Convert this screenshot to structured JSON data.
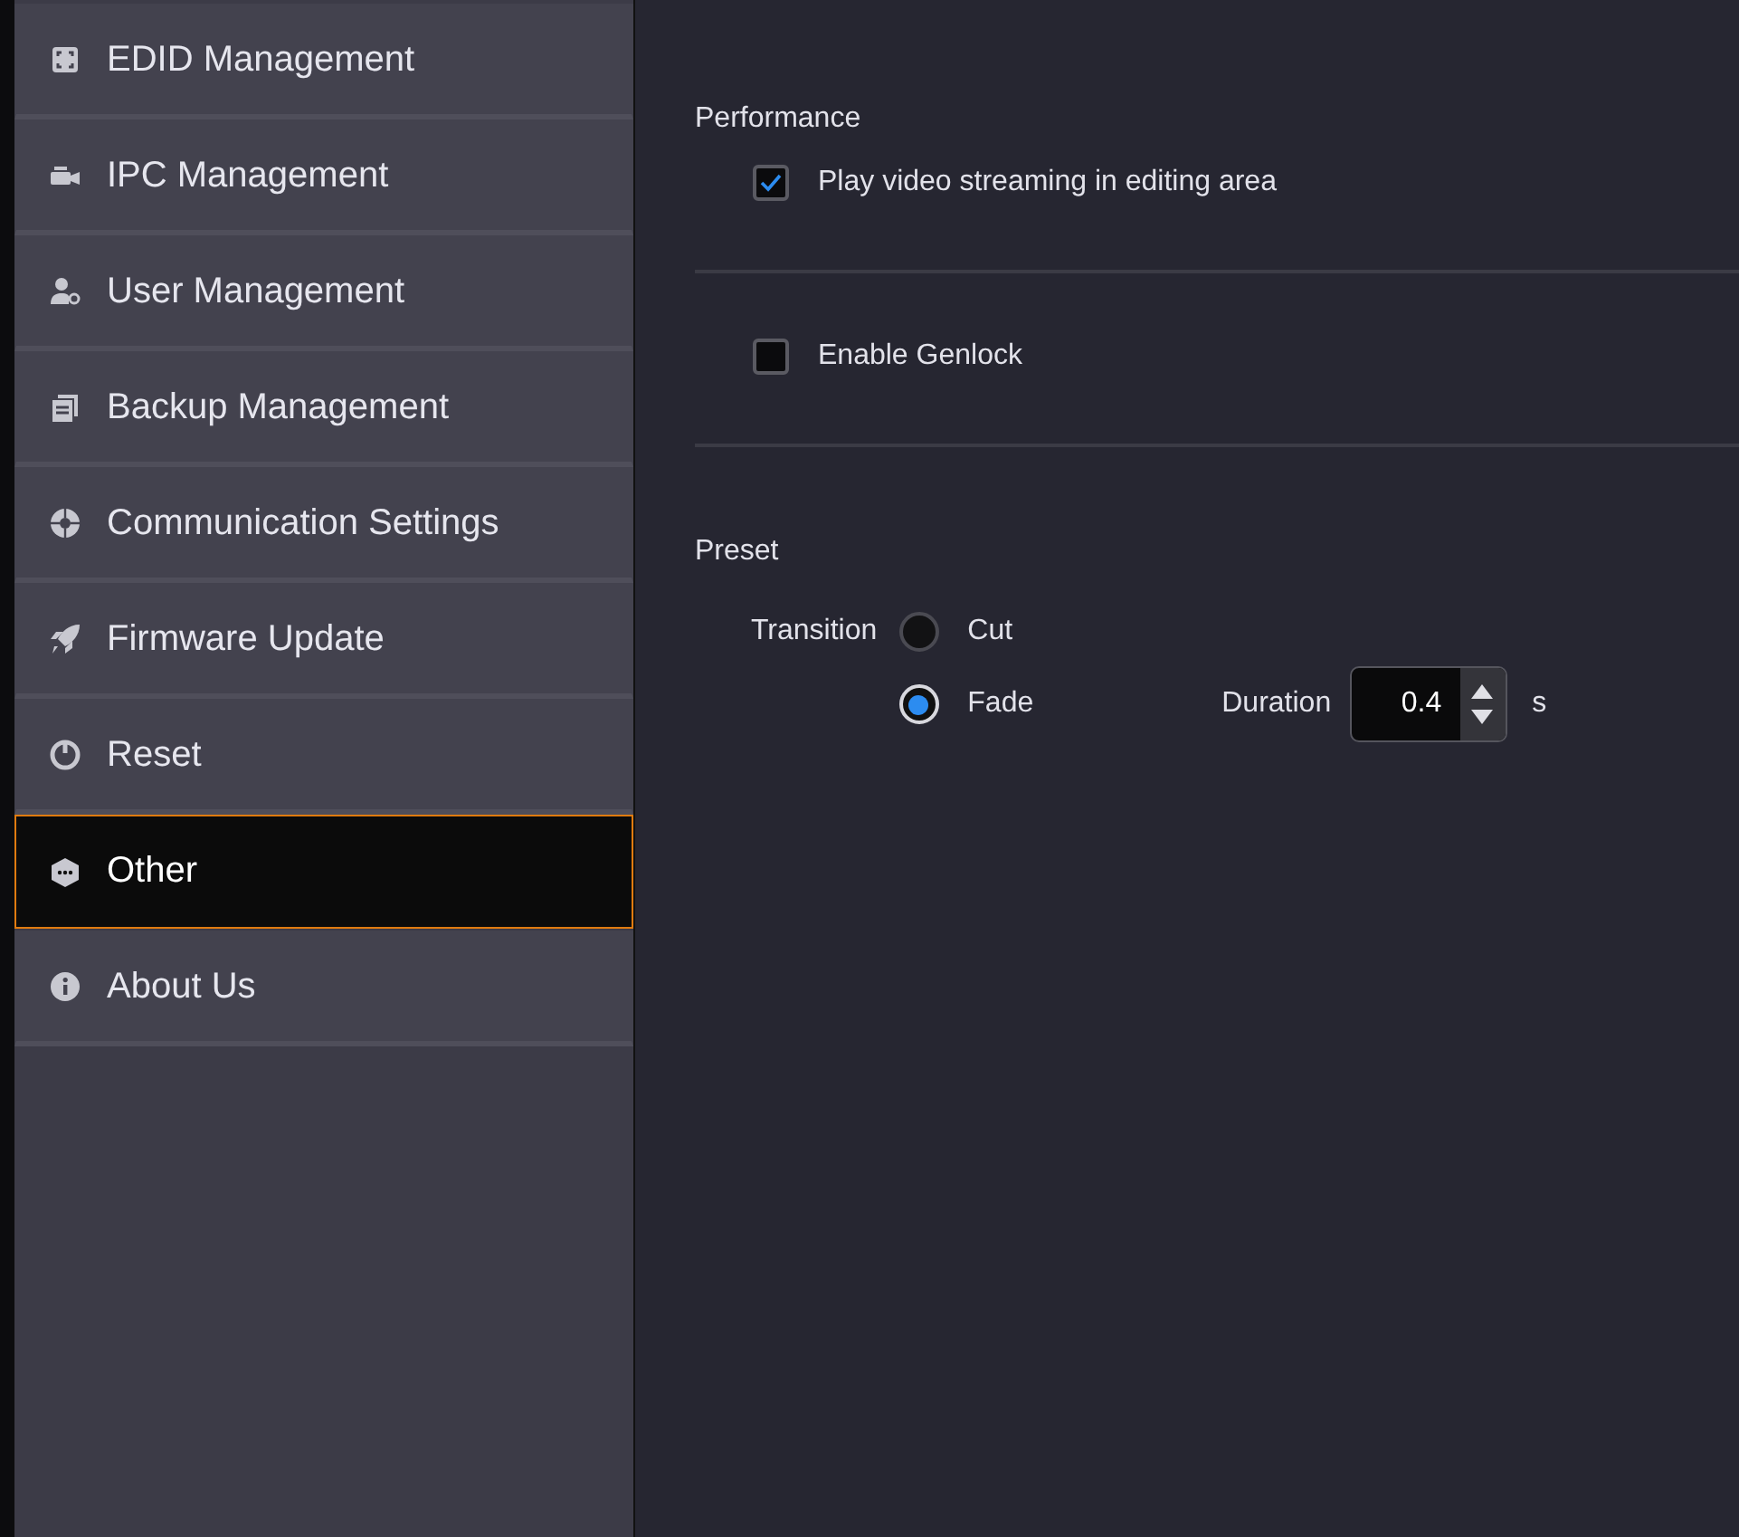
{
  "sidebar": {
    "items": [
      {
        "label": "EDID Management",
        "selected": false
      },
      {
        "label": "IPC Management",
        "selected": false
      },
      {
        "label": "User Management",
        "selected": false
      },
      {
        "label": "Backup Management",
        "selected": false
      },
      {
        "label": "Communication Settings",
        "selected": false
      },
      {
        "label": "Firmware Update",
        "selected": false
      },
      {
        "label": "Reset",
        "selected": false
      },
      {
        "label": "Other",
        "selected": true
      },
      {
        "label": "About Us",
        "selected": false
      }
    ]
  },
  "performance": {
    "title": "Performance",
    "options": [
      {
        "label": "Play video streaming in editing area",
        "checked": true
      }
    ]
  },
  "genlock": {
    "options": [
      {
        "label": "Enable Genlock",
        "checked": false
      }
    ]
  },
  "preset": {
    "title": "Preset",
    "transition": {
      "label": "Transition",
      "options": [
        {
          "label": "Cut",
          "selected": false
        },
        {
          "label": "Fade",
          "selected": true
        }
      ]
    },
    "duration": {
      "label": "Duration",
      "value": "0.4",
      "unit": "s"
    }
  }
}
